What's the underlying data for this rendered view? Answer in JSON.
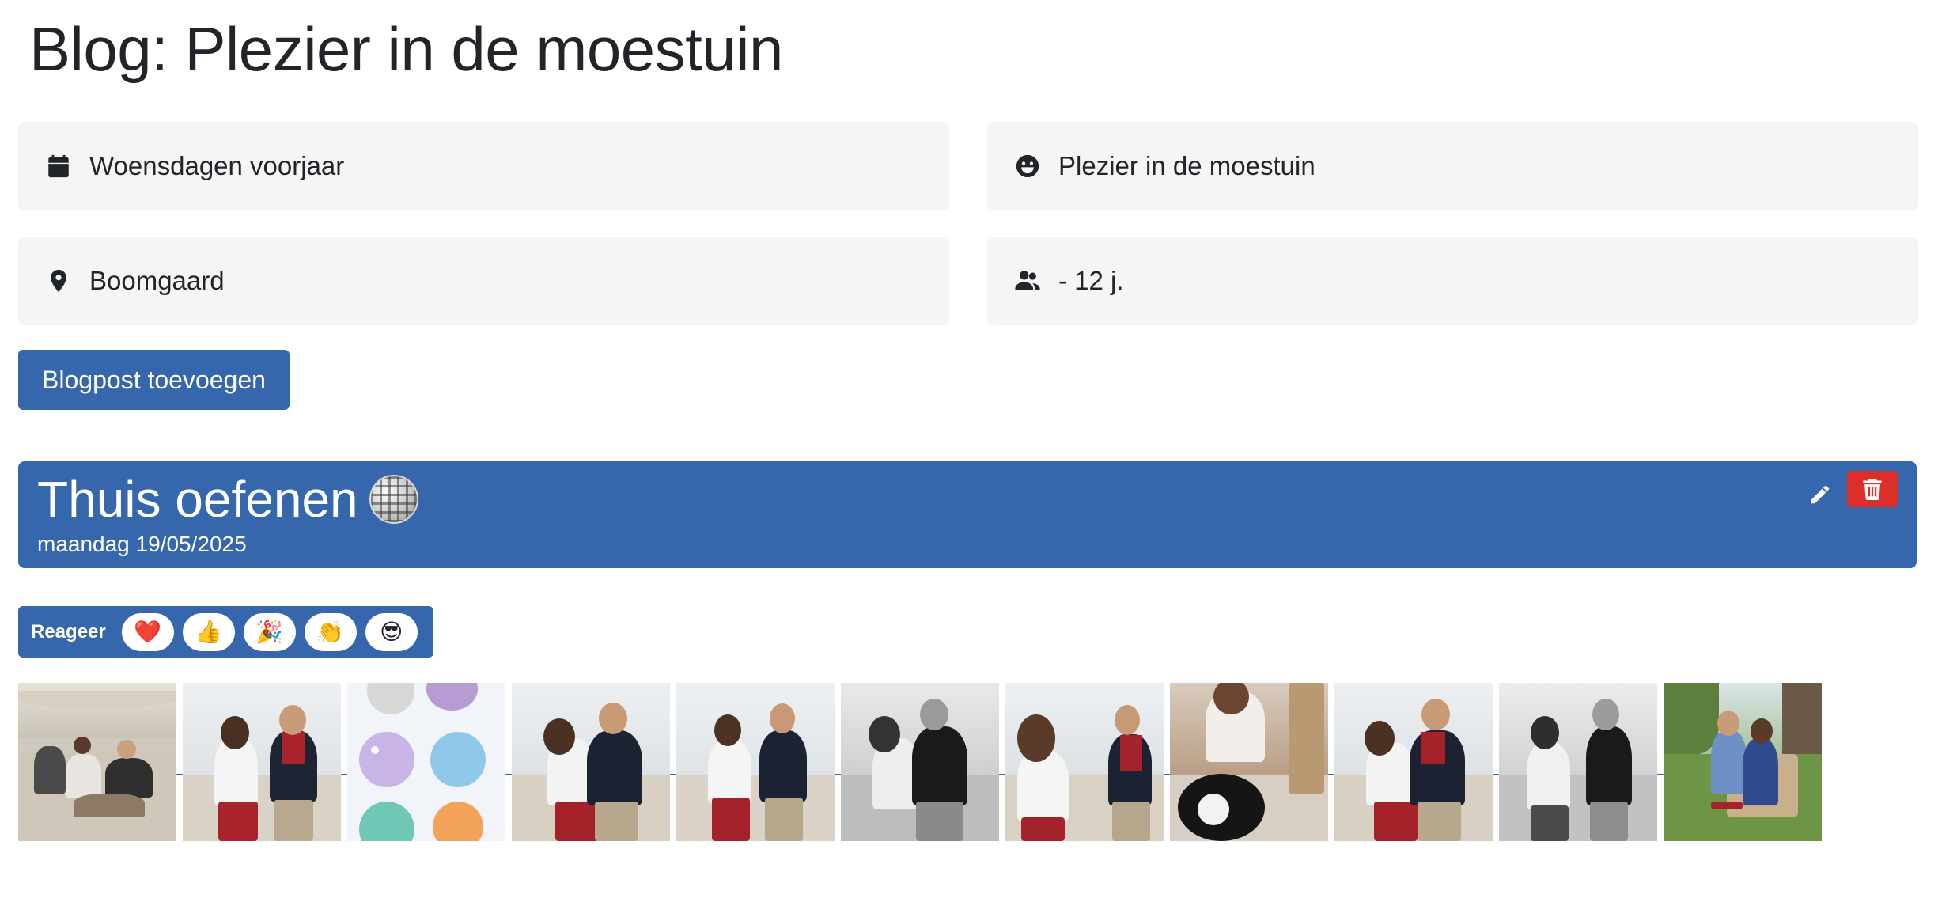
{
  "page": {
    "title": "Blog: Plezier in de moestuin"
  },
  "info": {
    "when": {
      "icon": "calendar-icon",
      "text": "Woensdagen voorjaar"
    },
    "theme": {
      "icon": "smile-icon",
      "text": "Plezier in de moestuin"
    },
    "location": {
      "icon": "map-pin-icon",
      "text": "Boomgaard"
    },
    "age": {
      "icon": "users-icon",
      "text": "- 12 j."
    }
  },
  "actions": {
    "add_post_label": "Blogpost toevoegen"
  },
  "post": {
    "title": "Thuis oefenen",
    "title_emoji": "disco-ball-icon",
    "date": "maandag 19/05/2025",
    "edit_icon": "pencil-icon",
    "delete_icon": "trash-icon"
  },
  "reactions": {
    "label": "Reageer",
    "items": [
      {
        "name": "heart",
        "emoji": "❤️"
      },
      {
        "name": "thumbs-up",
        "emoji": "👍"
      },
      {
        "name": "party-popper",
        "emoji": "🎉"
      },
      {
        "name": "clapping-hands",
        "emoji": "👏"
      },
      {
        "name": "sunglasses",
        "emoji": "😎"
      }
    ]
  },
  "colors": {
    "primary": "#3667ad",
    "danger": "#dc2f2a",
    "card_bg": "#f5f5f5",
    "text": "#212529"
  },
  "gallery": {
    "count": 11
  }
}
